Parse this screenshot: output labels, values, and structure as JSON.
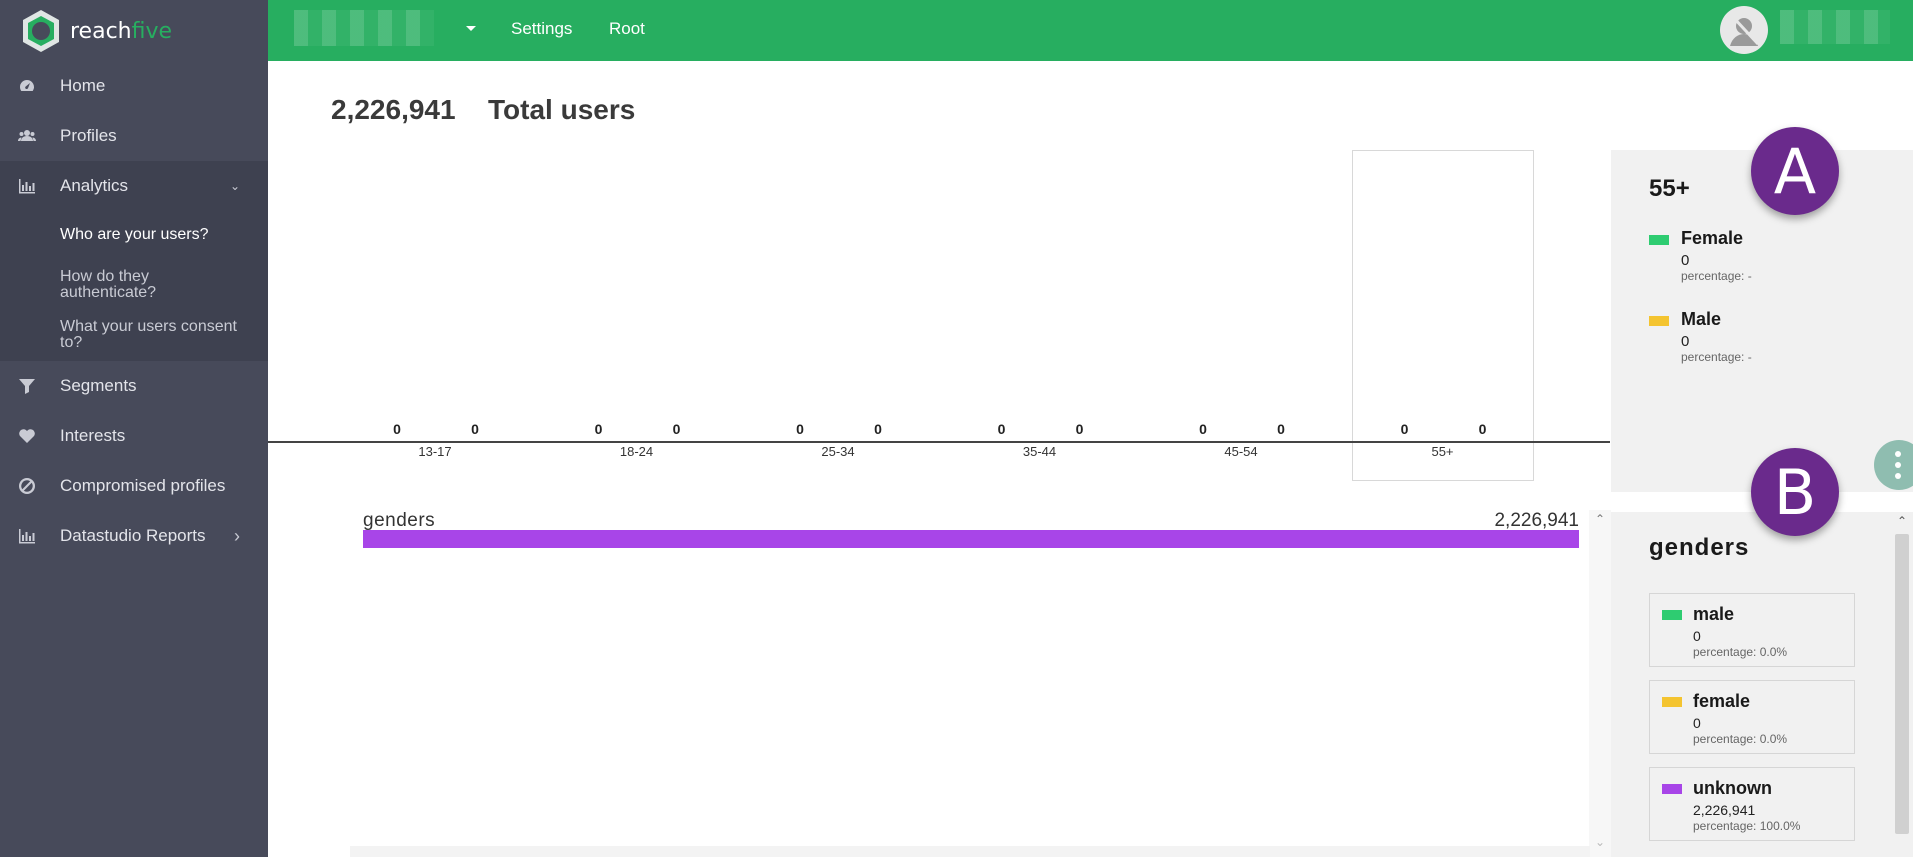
{
  "brand": {
    "name_part1": "reach",
    "name_part2": "five",
    "accent_color": "#27ae60"
  },
  "sidebar": {
    "items": [
      {
        "label": "Home",
        "icon": "dashboard-icon"
      },
      {
        "label": "Profiles",
        "icon": "users-icon"
      },
      {
        "label": "Analytics",
        "icon": "bar-chart-icon",
        "expanded": true
      },
      {
        "label": "Segments",
        "icon": "filter-icon"
      },
      {
        "label": "Interests",
        "icon": "heart-icon"
      },
      {
        "label": "Compromised profiles",
        "icon": "ban-icon"
      },
      {
        "label": "Datastudio Reports",
        "icon": "bar-chart-icon"
      }
    ],
    "analytics_sub": [
      {
        "label": "Who are your users?",
        "active": true
      },
      {
        "label": "How do they authenticate?"
      },
      {
        "label": "What your users consent to?"
      }
    ]
  },
  "topbar": {
    "nav": [
      "Settings",
      "Root"
    ]
  },
  "header": {
    "total_count": "2,226,941",
    "total_label": "Total users"
  },
  "chart_data": {
    "type": "bar",
    "categories": [
      "13-17",
      "18-24",
      "25-34",
      "35-44",
      "45-54",
      "55+"
    ],
    "series": [
      {
        "name": "Female",
        "color": "#2ecc71",
        "values": [
          0,
          0,
          0,
          0,
          0,
          0
        ]
      },
      {
        "name": "Male",
        "color": "#f4c430",
        "values": [
          0,
          0,
          0,
          0,
          0,
          0
        ]
      }
    ],
    "selected_category": "55+"
  },
  "panel_a": {
    "title": "55+",
    "entries": [
      {
        "name": "Female",
        "value": "0",
        "percentage": "percentage: -",
        "color": "#2ecc71"
      },
      {
        "name": "Male",
        "value": "0",
        "percentage": "percentage: -",
        "color": "#f4c430"
      }
    ]
  },
  "genders_bar": {
    "label": "genders",
    "total": "2,226,941",
    "color": "#a845e8"
  },
  "panel_b": {
    "title": "genders",
    "cards": [
      {
        "name": "male",
        "value": "0",
        "percentage": "percentage: 0.0%",
        "color": "#2ecc71"
      },
      {
        "name": "female",
        "value": "0",
        "percentage": "percentage: 0.0%",
        "color": "#f4c430"
      },
      {
        "name": "unknown",
        "value": "2,226,941",
        "percentage": "percentage: 100.0%",
        "color": "#a845e8"
      }
    ]
  },
  "badges": {
    "a": "A",
    "b": "B",
    "color": "#6a2a8c"
  }
}
